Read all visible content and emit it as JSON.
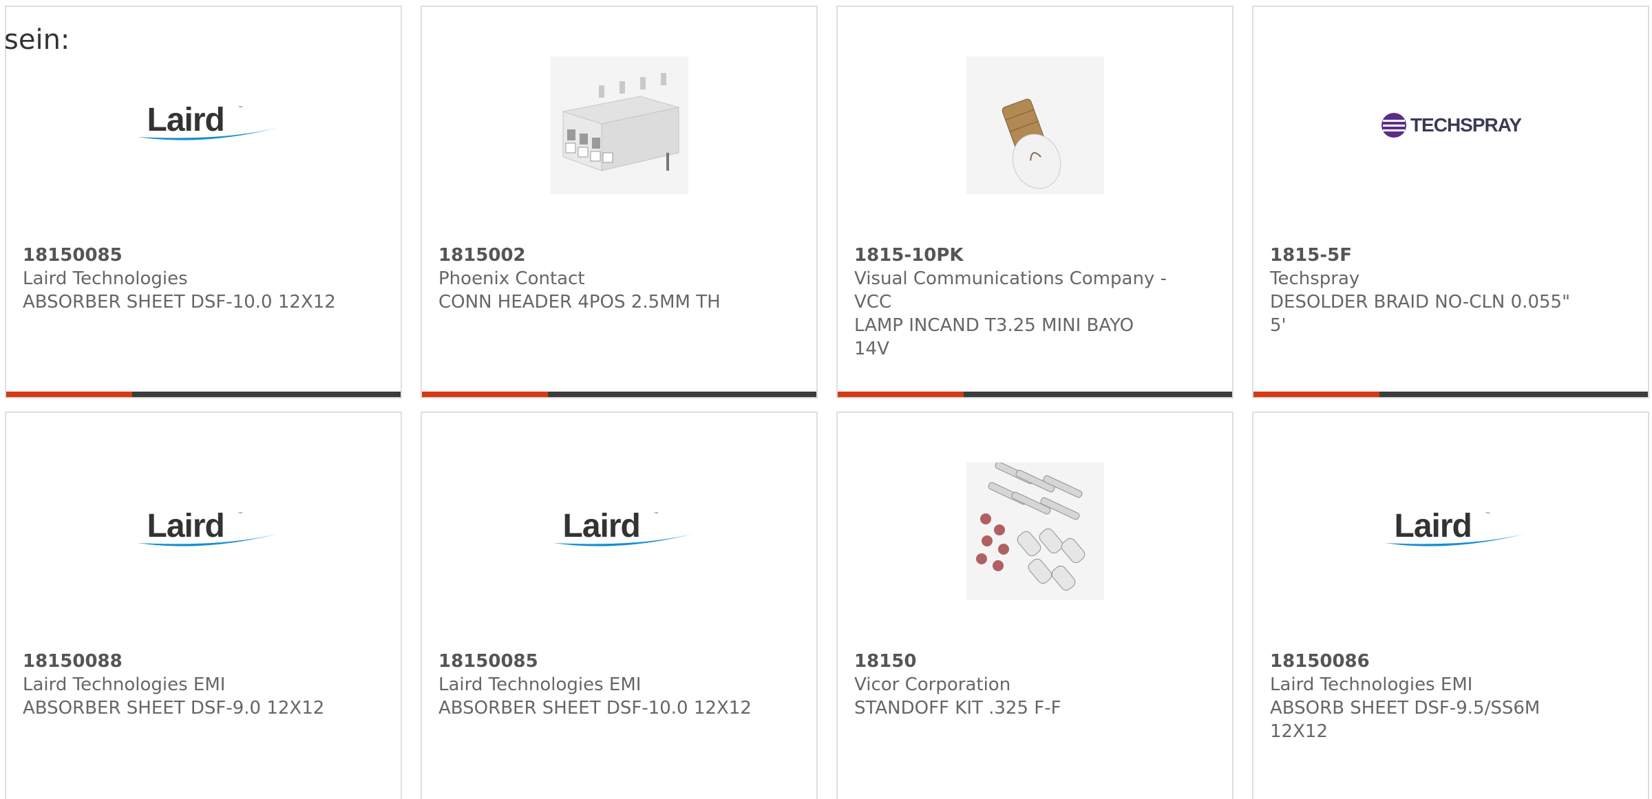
{
  "lead_text": "sein:",
  "colors": {
    "accent": "#d63a14",
    "bar_dark": "#3c3c3c",
    "laird_blue": "#1a8fd0",
    "techspray_purple": "#5b2d8a"
  },
  "products": [
    {
      "part_number": "18150085",
      "manufacturer": "Laird Technologies",
      "description": "ABSORBER SHEET DSF-10.0 12X12",
      "image": "laird-logo"
    },
    {
      "part_number": "1815002",
      "manufacturer": "Phoenix Contact",
      "description": "CONN HEADER 4POS 2.5MM TH",
      "image": "connector-header-photo"
    },
    {
      "part_number": "1815-10PK",
      "manufacturer": "Visual Communications Company - VCC",
      "description": "LAMP INCAND T3.25 MINI BAYO 14V",
      "image": "lamp-bulb-photo"
    },
    {
      "part_number": "1815-5F",
      "manufacturer": "Techspray",
      "description": "DESOLDER BRAID NO-CLN 0.055\" 5'",
      "image": "techspray-logo",
      "logo_text": "TECHSPRAY"
    },
    {
      "part_number": "18150088",
      "manufacturer": "Laird Technologies EMI",
      "description": "ABSORBER SHEET DSF-9.0 12X12",
      "image": "laird-logo"
    },
    {
      "part_number": "18150085",
      "manufacturer": "Laird Technologies EMI",
      "description": "ABSORBER SHEET DSF-10.0 12X12",
      "image": "laird-logo"
    },
    {
      "part_number": "18150",
      "manufacturer": "Vicor Corporation",
      "description": "STANDOFF KIT .325 F-F",
      "image": "standoff-kit-photo"
    },
    {
      "part_number": "18150086",
      "manufacturer": "Laird Technologies EMI",
      "description": "ABSORB SHEET DSF-9.5/SS6M 12X12",
      "image": "laird-logo"
    }
  ],
  "logos": {
    "laird": "Laird",
    "techspray": "TECHSPRAY"
  }
}
